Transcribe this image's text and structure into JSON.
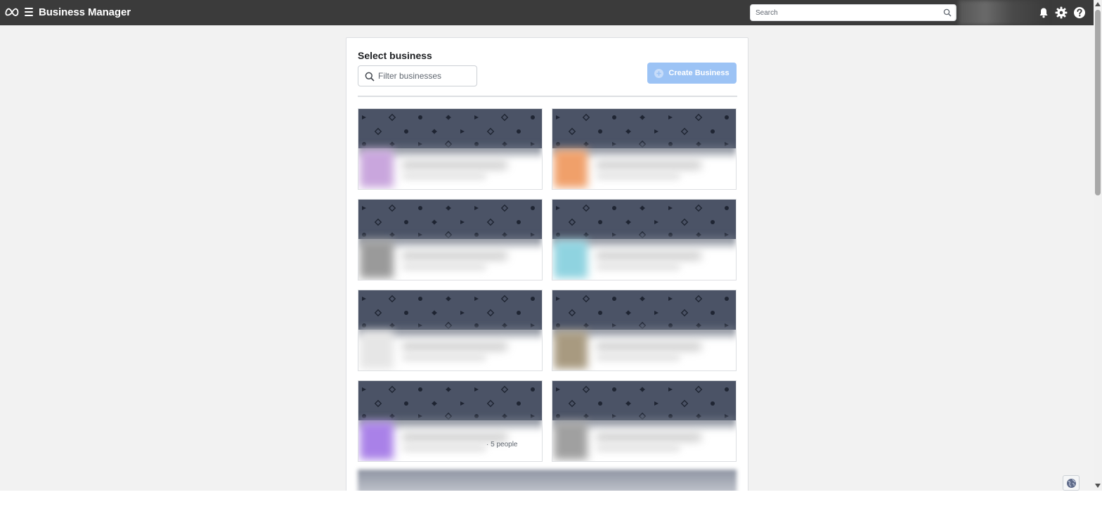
{
  "header": {
    "app_title": "Business Manager",
    "search_placeholder": "Search",
    "icons": [
      "meta-logo",
      "menu-icon",
      "search-icon",
      "bell-icon",
      "gear-icon",
      "help-icon"
    ]
  },
  "panel": {
    "title": "Select business",
    "filter_placeholder": "Filter businesses",
    "create_button_label": "Create Business",
    "create_button_color": "#9cc3f5"
  },
  "cards": [
    {
      "avatar_color": "#c9a6dd",
      "people_text": ""
    },
    {
      "avatar_color": "#f0a06a",
      "people_text": ""
    },
    {
      "avatar_color": "#9a9a9a",
      "people_text": ""
    },
    {
      "avatar_color": "#8fd3e0",
      "people_text": ""
    },
    {
      "avatar_color": "#e6e6e6",
      "people_text": ""
    },
    {
      "avatar_color": "#a89a80",
      "people_text": ""
    },
    {
      "avatar_color": "#a981e8",
      "people_text": "· 5 people"
    },
    {
      "avatar_color": "#a0a0a0",
      "people_text": ""
    }
  ],
  "colors": {
    "topbar": "#3b3b3b",
    "banner": "#4b5366",
    "page_bg": "#f2f2f2"
  }
}
